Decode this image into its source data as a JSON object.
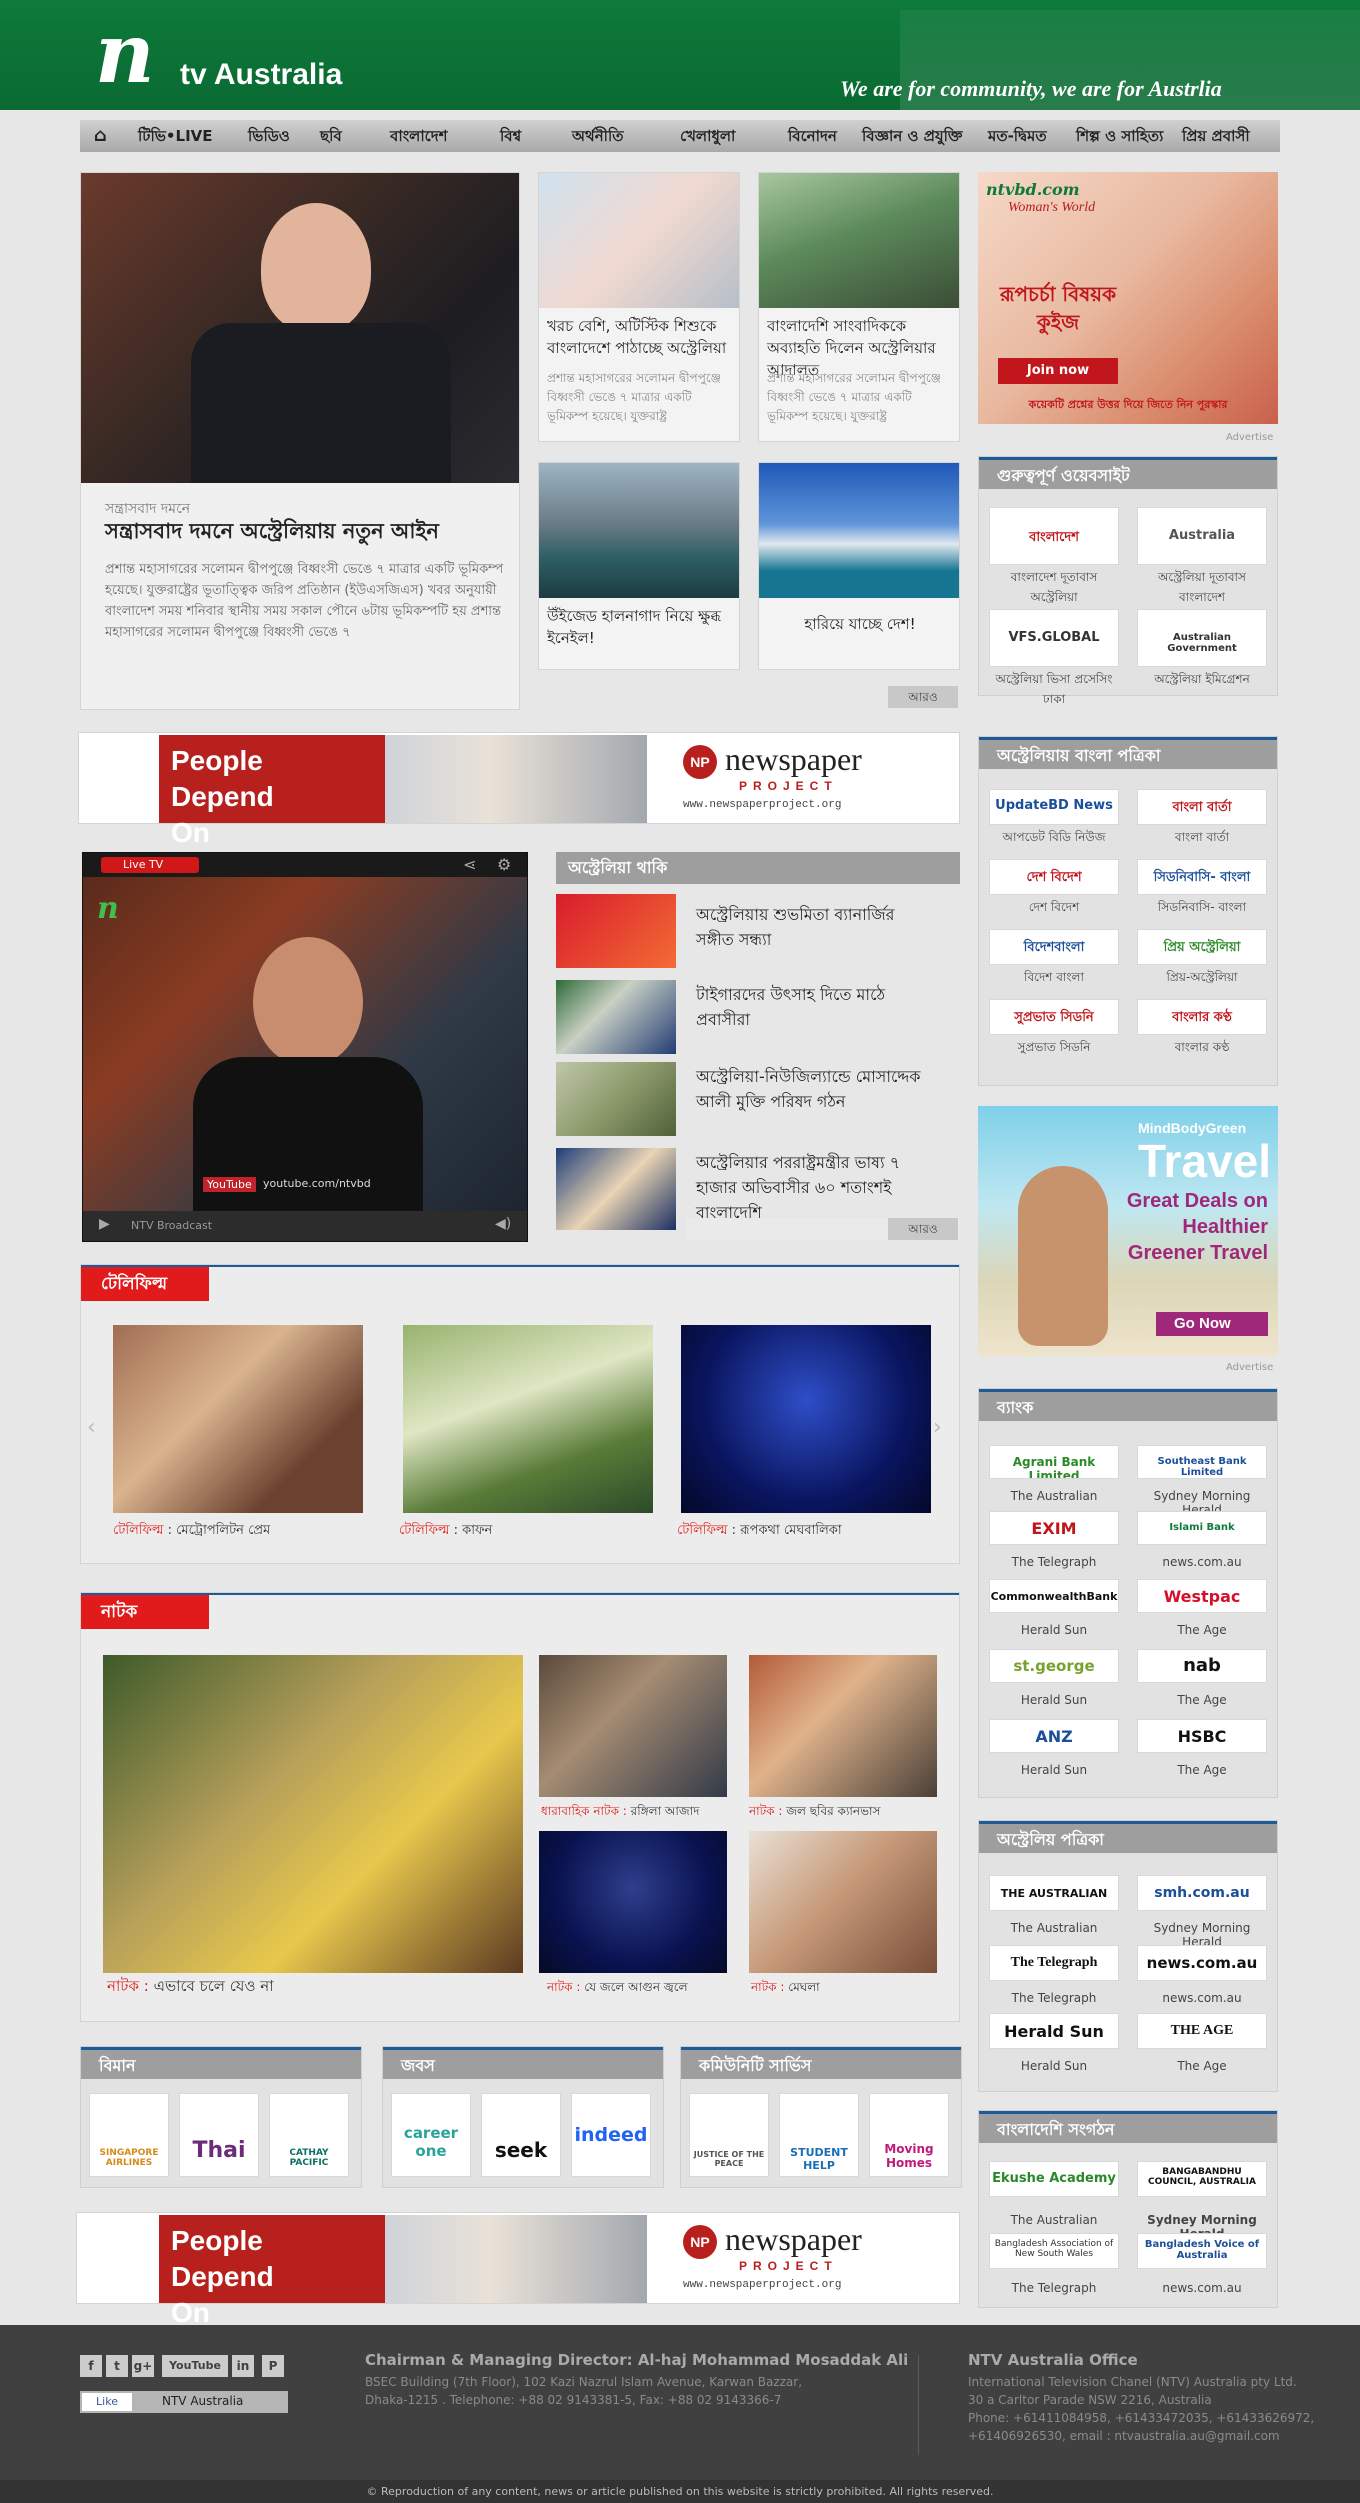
{
  "header": {
    "logo_n": "n",
    "logo_text": "tv Australia",
    "tagline": "We are for community, we are for Austrlia"
  },
  "nav": {
    "items": [
      "টিভি•LIVE",
      "ভিডিও",
      "ছবি",
      "বাংলাদেশ",
      "বিশ্ব",
      "অর্থনীতি",
      "খেলাধুলা",
      "বিনোদন",
      "বিজ্ঞান ও প্রযুক্তি",
      "মত-দ্বিমত",
      "শিল্প ও সাহিত্য",
      "প্রিয় প্রবাসী"
    ]
  },
  "lead": {
    "kicker": "সন্ত্রাসবাদ দমনে",
    "title": "সন্ত্রাসবাদ দমনে অস্ট্রেলিয়ায় নতুন আইন",
    "body": "প্রশান্ত মহাসাগরের সলোমন দ্বীপপুঞ্জে বিধ্বংসী ভেঙে ৭ মাত্রার একটি ভূমিকম্প হয়েছে। যুক্তরাষ্ট্রের ভূতাত্ত্বিক জরিপ প্রতিষ্ঠান (ইউএসজিএস) খবর অনুযায়ী বাংলাদেশ সময় শনিবার স্থানীয় সময় সকাল পৌনে ৬টায় ভূমিকম্পটি হয় প্রশান্ত মহাসাগরের সলোমন দ্বীপপুঞ্জে বিধ্বংসী ভেঙে ৭"
  },
  "cards": [
    {
      "title": "খরচ বেশি, অটিস্টিক শিশুকে বাংলাদেশে পাঠাচ্ছে অস্ট্রেলিয়া",
      "summary": "প্রশান্ত মহাসাগরের সলোমন দ্বীপপুঞ্জে বিধ্বংসী ভেঙে ৭ মাত্রার একটি ভূমিকম্প হয়েছে। যুক্তরাষ্ট্র"
    },
    {
      "title": "বাংলাদেশি সাংবাদিককে অব্যাহতি দিলেন অস্ট্রেলিয়ার আদালত",
      "summary": "প্রশান্ত মহাসাগরের সলোমন দ্বীপপুঞ্জে বিধ্বংসী ভেঙে ৭ মাত্রার একটি ভূমিকম্প হয়েছে। যুক্তরাষ্ট্র"
    },
    {
      "title": "উঁইজেড হালনাগাদ নিয়ে ক্ষুব্ধ ইনেইল!",
      "summary": ""
    },
    {
      "title": "হারিয়ে যাচ্ছে দেশ!",
      "summary": ""
    }
  ],
  "more_label": "আরও",
  "banner": {
    "line1": "People Depend",
    "line2": "On Newspapers.",
    "brand": "newspaper",
    "brand2": "PROJECT",
    "url": "www.newspaperproject.org"
  },
  "video": {
    "live_label": "Live TV",
    "footer_label": "NTV Broadcast",
    "youtube": "youtube.com/ntvbd"
  },
  "aus": {
    "heading": "অস্ট্রেলিয়া থাকি",
    "items": [
      "অস্ট্রেলিয়ায় শুভমিতা ব্যানার্জির সঙ্গীত সন্ধ্যা",
      "টাইগারদের উৎসাহ দিতে মাঠে প্রবাসীরা",
      "অস্ট্রেলিয়া-নিউজিল্যান্ডে মোসাদ্দেক আলী মুক্তি পরিষদ গঠন",
      "অস্ট্রেলিয়ার পররাষ্ট্রমন্ত্রীর ভাষ্য ৭ হাজার অভিবাসীর ৬০ শতাংশই বাংলাদেশি"
    ]
  },
  "telefilm": {
    "heading": "টেলিফিল্ম",
    "prefix": "টেলিফিল্ম",
    "items": [
      "মেট্রোপলিটন প্রেম",
      "কাফন",
      "রূপকথা মেঘবালিকা"
    ]
  },
  "natok": {
    "heading": "নাটক",
    "lead_prefix": "নাটক :",
    "lead": "এভাবে চলে যেও না",
    "items": [
      {
        "prefix": "ধারাবাহিক নাটক :",
        "title": "রঙ্গিলা আজাদ"
      },
      {
        "prefix": "নাটক :",
        "title": "জল ছবির ক্যানভাস"
      },
      {
        "prefix": "নাটক :",
        "title": "যে জলে আগুন জ্বলে"
      },
      {
        "prefix": "নাটক :",
        "title": "মেঘলা"
      }
    ]
  },
  "bottom_boxes": [
    {
      "heading": "বিমান",
      "logos": [
        "SINGAPORE AIRLINES",
        "Thai",
        "CATHAY PACIFIC"
      ]
    },
    {
      "heading": "জবস",
      "logos": [
        "career one",
        "seek",
        "indeed"
      ]
    },
    {
      "heading": "কমিউনিটি সার্ভিস",
      "logos": [
        "JUSTICE OF THE PEACE",
        "STUDENT HELP",
        "Moving Homes"
      ]
    }
  ],
  "ad_top": {
    "brand": "ntvbd.com",
    "line1": "Woman's World",
    "headline": "রূপচর্চা বিষয়ক কুইজ",
    "join": "Join now",
    "footer": "কয়েকটি প্রশ্নের উত্তর দিয়ে জিতে নিন পুরস্কার",
    "advertise": "Advertise"
  },
  "ad_travel": {
    "brand": "MindBodyGreen",
    "headline": "Travel",
    "sub": "Great Deals on Healthier Greener Travel",
    "cta": "Go Now",
    "advertise": "Advertise"
  },
  "sidebar": {
    "websites": {
      "heading": "গুরুত্বপূর্ণ ওয়েবসাইট",
      "items": [
        {
          "logo": "বাংলাদেশ",
          "caption": "বাংলাদেশ দূতাবাস অস্ট্রেলিয়া"
        },
        {
          "logo": "Australia",
          "caption": "অস্ট্রেলিয়া দূতাবাস বাংলাদেশ"
        },
        {
          "logo": "VFS.GLOBAL",
          "caption": "অস্ট্রেলিয়া ভিসা প্রসেসিং ঢাকা"
        },
        {
          "logo": "Australian Government",
          "caption": "অস্ট্রেলিয়া ইমিগ্রেশন"
        }
      ]
    },
    "papers_bn": {
      "heading": "অস্ট্রেলিয়ায় বাংলা পত্রিকা",
      "items": [
        {
          "logo": "UpdateBD News",
          "caption": "আপডেট বিডি নিউজ"
        },
        {
          "logo": "বাংলা বার্তা",
          "caption": "বাংলা বার্তা"
        },
        {
          "logo": "দেশ বিদেশ",
          "caption": "দেশ বিদেশ"
        },
        {
          "logo": "সিডনিবাসি- বাংলা",
          "caption": "সিডনিবাসি- বাংলা"
        },
        {
          "logo": "বিদেশবাংলা",
          "caption": "বিদেশ বাংলা"
        },
        {
          "logo": "প্রিয় অস্ট্রেলিয়া",
          "caption": "প্রিয়-অস্ট্রেলিয়া"
        },
        {
          "logo": "সুপ্রভাত সিডনি",
          "caption": "সুপ্রভাত সিডনি"
        },
        {
          "logo": "বাংলার কণ্ঠ",
          "caption": "বাংলার কণ্ঠ"
        }
      ]
    },
    "banks": {
      "heading": "ব্যাংক",
      "items": [
        {
          "logo": "Agrani Bank Limited",
          "caption": "The Australian"
        },
        {
          "logo": "Southeast Bank Limited",
          "caption": "Sydney Morning Herald"
        },
        {
          "logo": "EXIM",
          "caption": "The Telegraph"
        },
        {
          "logo": "Islami Bank",
          "caption": "news.com.au"
        },
        {
          "logo": "CommonwealthBank",
          "caption": "Herald Sun"
        },
        {
          "logo": "Westpac",
          "caption": "The Age"
        },
        {
          "logo": "st.george",
          "caption": "Herald Sun"
        },
        {
          "logo": "nab",
          "caption": "The Age"
        },
        {
          "logo": "ANZ",
          "caption": "Herald Sun"
        },
        {
          "logo": "HSBC",
          "caption": "The Age"
        }
      ]
    },
    "papers_au": {
      "heading": "অস্ট্রেলিয় পত্রিকা",
      "items": [
        {
          "logo": "THE AUSTRALIAN",
          "caption": "The Australian"
        },
        {
          "logo": "smh.com.au",
          "caption": "Sydney Morning Herald"
        },
        {
          "logo": "The Telegraph",
          "caption": "The Telegraph"
        },
        {
          "logo": "news.com.au",
          "caption": "news.com.au"
        },
        {
          "logo": "Herald Sun",
          "caption": "Herald Sun"
        },
        {
          "logo": "THE AGE",
          "caption": "The Age"
        }
      ]
    },
    "orgs": {
      "heading": "বাংলাদেশি সংগঠন",
      "items": [
        {
          "logo": "Ekushe Academy",
          "caption": "The Australian"
        },
        {
          "logo": "BANGABANDHU COUNCIL, AUSTRALIA",
          "caption": "Sydney Morning Herald"
        },
        {
          "logo": "Bangladesh Association of New South Wales",
          "caption": "The Telegraph"
        },
        {
          "logo": "Bangladesh Voice of Australia",
          "caption": "news.com.au"
        }
      ]
    }
  },
  "footer": {
    "social": [
      "f",
      "t",
      "g+",
      "YouTube",
      "in",
      "P"
    ],
    "like": "Like",
    "like_page": "NTV Australia",
    "chair_title": "Chairman & Managing Director: Al-haj Mohammad Mosaddak Ali",
    "chair_lines": [
      "BSEC Building (7th Floor), 102 Kazi Nazrul Islam Avenue, Karwan Bazzar,",
      "Dhaka-1215 . Telephone: +88 02 9143381-5, Fax: +88 02 9143366-7"
    ],
    "office_title": "NTV Australia Office",
    "office_lines": [
      "International Television Chanel (NTV) Australia pty Ltd.",
      "30 a Carltor Parade NSW 2216, Australia",
      "Phone: +61411084958, +61433472035, +61433626972,",
      "+61406926530, email : ntvaustralia.au@gmail.com"
    ],
    "copyright": "© Reproduction of any content, news or article published on this website is strictly prohibited. All rights reserved."
  },
  "colors": {
    "brand_green": "#0d7a3a",
    "accent_red": "#e11b1b",
    "accent_blue": "#1e5a9a"
  }
}
